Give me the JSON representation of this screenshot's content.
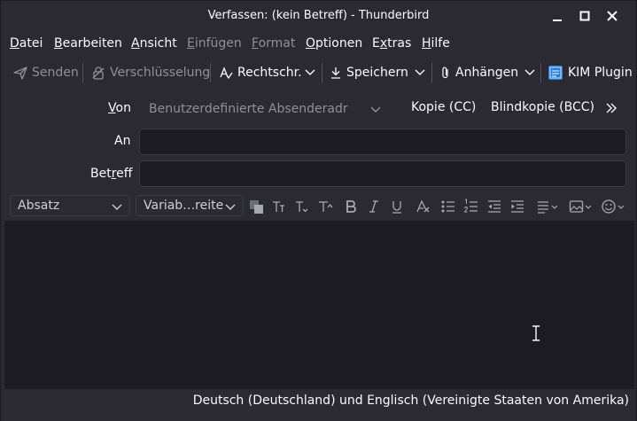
{
  "window": {
    "title": "Verfassen: (kein Betreff) - Thunderbird"
  },
  "menu": {
    "items": [
      {
        "label": "Datei",
        "accel": "D",
        "rest": "atei",
        "disabled": false
      },
      {
        "label": "Bearbeiten",
        "accel": "B",
        "rest": "earbeiten",
        "disabled": false
      },
      {
        "label": "Ansicht",
        "accel": "A",
        "rest": "nsicht",
        "disabled": false
      },
      {
        "label": "Einfügen",
        "accel": "E",
        "rest": "infügen",
        "disabled": true
      },
      {
        "label": "Format",
        "accel": "F",
        "rest": "ormat",
        "disabled": true
      },
      {
        "label": "Optionen",
        "accel": "O",
        "rest": "ptionen",
        "disabled": false
      },
      {
        "label": "Extras",
        "accel": "x",
        "pre": "E",
        "rest": "tras",
        "disabled": false
      },
      {
        "label": "Hilfe",
        "accel": "H",
        "rest": "ilfe",
        "disabled": false
      }
    ]
  },
  "toolbar": {
    "send_label": "Senden",
    "encryption_label": "Verschlüsselung",
    "spelling_label": "Rechtschr.",
    "save_label": "Speichern",
    "attach_label": "Anhängen",
    "kim_label": "KIM Plugin"
  },
  "header": {
    "from_label_accel": "V",
    "from_label_rest": "on",
    "from_placeholder": "Benutzerdefinierte Absenderadr",
    "cc_label": "Kopie (CC)",
    "bcc_label": "Blindkopie (BCC)",
    "to_label": "An",
    "subject_label_pre": "Bet",
    "subject_label_accel": "r",
    "subject_label_rest": "eff",
    "to_value": "",
    "subject_value": ""
  },
  "format": {
    "paragraph_select": "Absatz",
    "font_select": "Variab…reite"
  },
  "status": {
    "language": "Deutsch (Deutschland) und Englisch (Vereinigte Staaten von Amerika)"
  },
  "colors": {
    "background": "#2b2a33",
    "editor": "#1c1b22",
    "field": "#1c1b22",
    "text": "#fbfbfe",
    "disabled": "#8f8f9d",
    "kim_icon": "#2a7fd4"
  }
}
